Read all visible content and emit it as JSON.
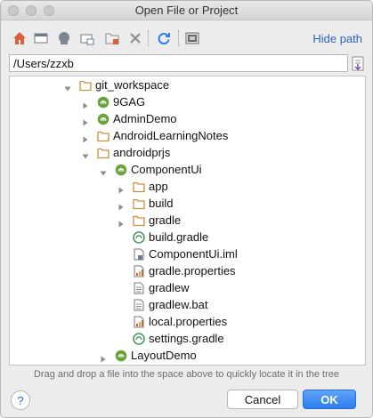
{
  "window": {
    "title": "Open File or Project"
  },
  "toolbar": {
    "hide_path_label": "Hide path",
    "icons": [
      "home-icon",
      "desktop-icon",
      "project-icon",
      "module-icon",
      "new-folder-icon",
      "delete-icon",
      "refresh-icon",
      "show-hidden-icon"
    ]
  },
  "path": {
    "value": "/Users/zzxb"
  },
  "tree": {
    "rows": [
      {
        "label": "git_workspace",
        "type": "folder",
        "expanded": true
      },
      {
        "label": "9GAG",
        "type": "android-project",
        "expanded": false
      },
      {
        "label": "AdminDemo",
        "type": "android-project",
        "expanded": false
      },
      {
        "label": "AndroidLearningNotes",
        "type": "folder",
        "expanded": false
      },
      {
        "label": "androidprjs",
        "type": "folder",
        "expanded": true
      },
      {
        "label": "ComponentUi",
        "type": "android-project",
        "expanded": true
      },
      {
        "label": "app",
        "type": "folder",
        "expanded": false
      },
      {
        "label": "build",
        "type": "folder",
        "expanded": false
      },
      {
        "label": "gradle",
        "type": "folder",
        "expanded": false
      },
      {
        "label": "build.gradle",
        "type": "gradle-file"
      },
      {
        "label": "ComponentUi.iml",
        "type": "iml-file"
      },
      {
        "label": "gradle.properties",
        "type": "properties-file"
      },
      {
        "label": "gradlew",
        "type": "text-file"
      },
      {
        "label": "gradlew.bat",
        "type": "text-file"
      },
      {
        "label": "local.properties",
        "type": "properties-file"
      },
      {
        "label": "settings.gradle",
        "type": "gradle-file"
      },
      {
        "label": "LayoutDemo",
        "type": "android-project",
        "expanded": false
      }
    ]
  },
  "hint": "Drag and drop a file into the space above to quickly locate it in the tree",
  "buttons": {
    "help": "?",
    "cancel": "Cancel",
    "ok": "OK"
  },
  "colors": {
    "accent": "#2d7cf0",
    "link": "#2d63b8",
    "folder": "#d39b3a",
    "android": "#7cb342"
  }
}
